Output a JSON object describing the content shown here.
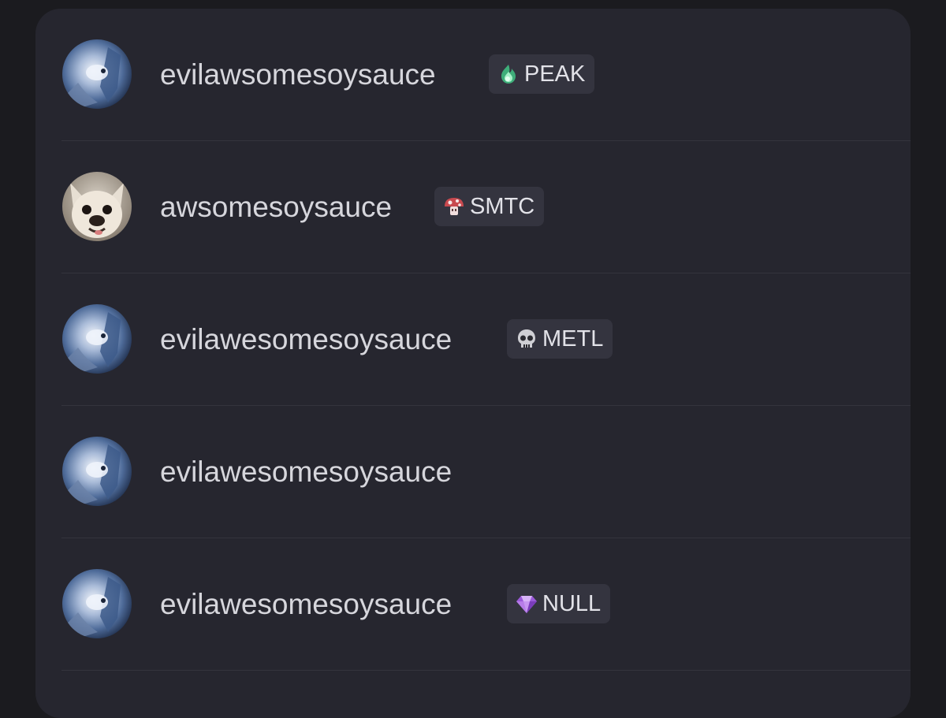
{
  "members": [
    {
      "username": "evilawsomesoysauce",
      "avatar": "blue-figure-avatar",
      "tag": {
        "label": "PEAK",
        "icon": "green-flame-icon"
      }
    },
    {
      "username": "awsomesoysauce",
      "avatar": "dog-avatar",
      "tag": {
        "label": "SMTC",
        "icon": "mushroom-icon"
      }
    },
    {
      "username": "evilawesomesoysauce",
      "avatar": "blue-figure-avatar",
      "tag": {
        "label": "METL",
        "icon": "skull-icon"
      }
    },
    {
      "username": "evilawesomesoysauce",
      "avatar": "blue-figure-avatar",
      "tag": null
    },
    {
      "username": "evilawesomesoysauce",
      "avatar": "blue-figure-avatar",
      "tag": {
        "label": "NULL",
        "icon": "purple-gem-icon"
      }
    }
  ],
  "colors": {
    "page_background": "#1b1b1f",
    "panel_background": "#26262f",
    "tag_background": "#34343f",
    "username_text": "#d6d6dc"
  }
}
